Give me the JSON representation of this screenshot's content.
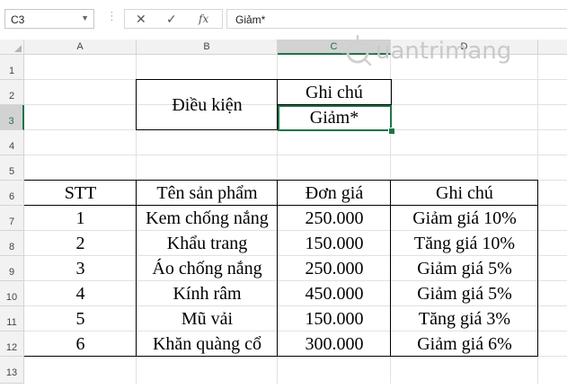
{
  "formula_bar": {
    "name_box": "C3",
    "name_box_arrow": "▼",
    "separator": "⋮",
    "cancel_icon": "✕",
    "enter_icon": "✓",
    "function_icon": "fx",
    "formula": "Giảm*"
  },
  "columns": [
    "A",
    "B",
    "C",
    "D"
  ],
  "rows": [
    "1",
    "2",
    "3",
    "4",
    "5",
    "6",
    "7",
    "8",
    "9",
    "10",
    "11",
    "12",
    "13"
  ],
  "condition_table": {
    "label": "Điều kiện",
    "header": "Ghi chú",
    "value": "Giảm*"
  },
  "product_table": {
    "headers": [
      "STT",
      "Tên sản phẩm",
      "Đơn giá",
      "Ghi chú"
    ],
    "rows": [
      [
        "1",
        "Kem chống nắng",
        "250.000",
        "Giảm giá 10%"
      ],
      [
        "2",
        "Khẩu trang",
        "150.000",
        "Tăng giá 10%"
      ],
      [
        "3",
        "Áo chống nắng",
        "250.000",
        "Giảm giá 5%"
      ],
      [
        "4",
        "Kính râm",
        "450.000",
        "Giảm giá 5%"
      ],
      [
        "5",
        "Mũ vải",
        "150.000",
        "Tăng giá 3%"
      ],
      [
        "6",
        "Khăn quàng cổ",
        "300.000",
        "Giảm giá 6%"
      ]
    ]
  },
  "watermark": {
    "text": "uantrimang",
    "icon": "quantrimang-logo-icon"
  },
  "colors": {
    "selection": "#217346",
    "header_bg": "#f2f2f2",
    "gridline": "#e1e1e1"
  }
}
